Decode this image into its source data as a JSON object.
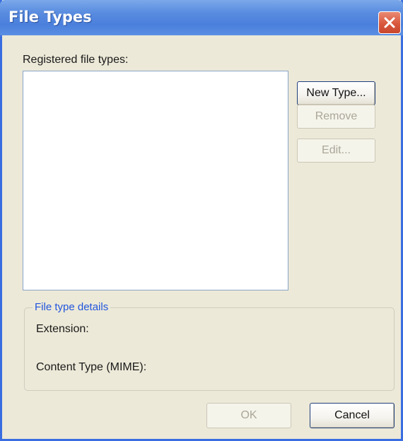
{
  "window": {
    "title": "File Types"
  },
  "icons": {
    "close": "close-icon"
  },
  "list": {
    "label": "Registered file types:",
    "items": []
  },
  "buttons": {
    "new_type": "New Type...",
    "remove": "Remove",
    "edit": "Edit...",
    "ok": "OK",
    "cancel": "Cancel"
  },
  "details": {
    "group_title": "File type details",
    "extension_label": "Extension:",
    "extension_value": "",
    "content_type_label": "Content Type (MIME):",
    "content_type_value": ""
  },
  "colors": {
    "titlebar": "#4a7fdc",
    "window_bg": "#ece9d8",
    "group_title": "#2255dd",
    "close_button": "#d9583d"
  }
}
